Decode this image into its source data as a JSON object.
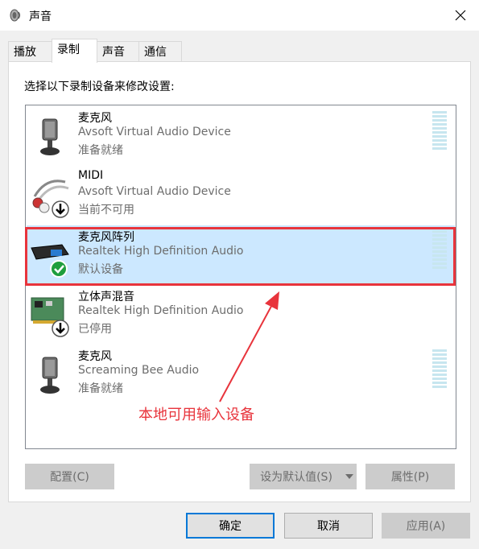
{
  "window": {
    "title": "声音"
  },
  "tabs": [
    {
      "label": "播放"
    },
    {
      "label": "录制"
    },
    {
      "label": "声音"
    },
    {
      "label": "通信"
    }
  ],
  "instruction": "选择以下录制设备来修改设置:",
  "devices": [
    {
      "name": "麦克风",
      "description": "Avsoft Virtual Audio Device",
      "status": "准备就绪",
      "icon": "microphone-icon"
    },
    {
      "name": "MIDI",
      "description": "Avsoft Virtual Audio Device",
      "status": "当前不可用",
      "icon": "midi-cable-icon"
    },
    {
      "name": "麦克风阵列",
      "description": "Realtek High Definition Audio",
      "status": "默认设备",
      "icon": "microphone-array-icon"
    },
    {
      "name": "立体声混音",
      "description": "Realtek High Definition Audio",
      "status": "已停用",
      "icon": "sound-card-icon"
    },
    {
      "name": "麦克风",
      "description": "Screaming Bee Audio",
      "status": "准备就绪",
      "icon": "microphone-icon"
    }
  ],
  "annotation": "本地可用输入设备",
  "buttons": {
    "configure": "配置(C)",
    "set_default": "设为默认值(S)",
    "properties": "属性(P)",
    "ok": "确定",
    "cancel": "取消",
    "apply": "应用(A)"
  },
  "colors": {
    "selection": "#cce8ff",
    "annotation": "#e8343c",
    "accent": "#0078d7"
  }
}
